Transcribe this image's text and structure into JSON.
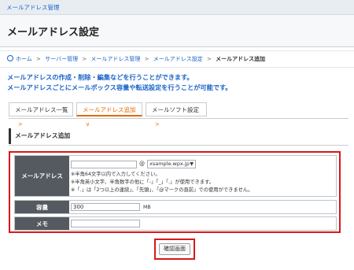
{
  "header": {
    "app_name": "メールアドレス管理",
    "page_title": "メールアドレス設定"
  },
  "breadcrumb": {
    "items": [
      "ホーム",
      "サーバー管理",
      "メールアドレス管理",
      "メールアドレス設定"
    ],
    "separator": ">",
    "current": "メールアドレス追加"
  },
  "description": {
    "line1": "メールアドレスの作成・削除・編集などを行うことができます。",
    "line2": "メールアドレスごとにメールボックス容量や転送設定を行うことが可能です。"
  },
  "tabs": [
    {
      "label": "メールアドレス一覧",
      "chevron": ">"
    },
    {
      "label": "メールアドレス追加",
      "chevron": "∨"
    },
    {
      "label": "メールソフト設定",
      "chevron": ">"
    }
  ],
  "section": {
    "title": "メールアドレス追加"
  },
  "form": {
    "email": {
      "label": "メールアドレス",
      "value": "",
      "at": "@",
      "domain_selected": "xsample.wpx.jp",
      "notes": [
        "※半角64文字以内で入力してください。",
        "※半角英小文字、半角数字の他に「-」「_」「.」が使用できます。",
        "※「.」は「2つ以上の連続」、「先頭」、「@マークの直前」での使用ができません。"
      ]
    },
    "capacity": {
      "label": "容量",
      "value": "300",
      "unit": "MB"
    },
    "memo": {
      "label": "メモ",
      "value": ""
    }
  },
  "actions": {
    "confirm_label": "確認画面"
  },
  "colors": {
    "accent": "#e06b00",
    "link": "#1a64c8",
    "highlight": "#d81818"
  }
}
